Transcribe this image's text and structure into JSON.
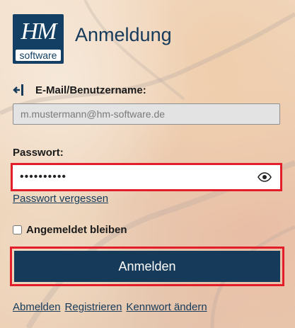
{
  "logo": {
    "monogram": "HM",
    "subtitle": "software"
  },
  "title": "Anmeldung",
  "email": {
    "label": "E-Mail/Benutzername:",
    "value": "m.mustermann@hm-software.de",
    "icon": "login-arrow-icon"
  },
  "password": {
    "label": "Passwort:",
    "value": "••••••••••",
    "toggle_icon": "eye-icon"
  },
  "forgot_link": "Passwort vergessen",
  "remember": {
    "label": "Angemeldet bleiben",
    "checked": false
  },
  "submit_label": "Anmelden",
  "footer_links": [
    "Abmelden",
    "Registrieren",
    "Kennwort ändern"
  ],
  "colors": {
    "primary": "#163a5a",
    "highlight": "#e31e2b"
  }
}
